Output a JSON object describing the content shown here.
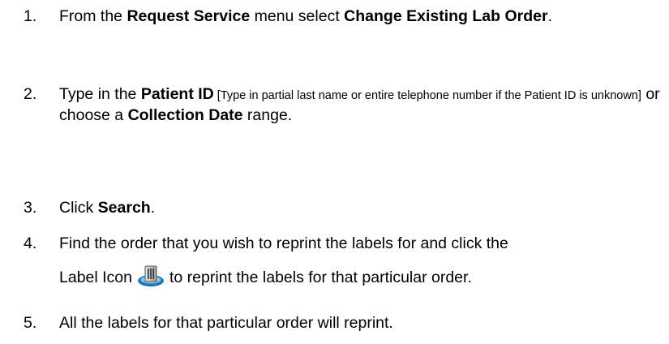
{
  "steps": [
    {
      "number": "1.",
      "t1": "From the ",
      "b1": "Request Service",
      "t2": " menu select ",
      "b2": "Change Existing Lab Order",
      "t3": "."
    },
    {
      "number": "2.",
      "t1": "Type in the ",
      "b1": "Patient ID",
      "small": " [Type in partial last name or entire telephone number if the Patient ID is unknown]",
      "t2": " or choose a ",
      "b2": "Collection Date",
      "t3": " range."
    },
    {
      "number": "3.",
      "t1": "Click ",
      "b1": "Search",
      "t2": "."
    },
    {
      "number": "4.",
      "t1": "Find the order that you wish to reprint the labels for and click the",
      "t2": "Label Icon",
      "icon": "label-printer-icon",
      "t3": "to reprint the labels for that particular order."
    },
    {
      "number": "5.",
      "t1": "All the labels for that particular order will reprint."
    }
  ]
}
